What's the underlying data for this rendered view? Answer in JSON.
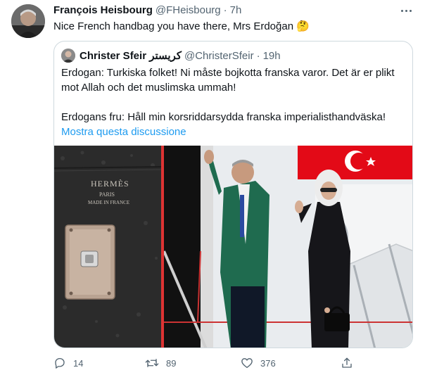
{
  "tweet": {
    "author_name": "François Heisbourg",
    "author_handle": "@FHeisbourg",
    "separator": "·",
    "time": "7h",
    "text": "Nice French handbag you have there, Mrs Erdoğan 🤔"
  },
  "quoted": {
    "author_name": "Christer Sfeir كريستر",
    "author_handle": "@ChristerSfeir",
    "separator": "·",
    "time": "19h",
    "line1": "Erdogan: Turkiska folket! Ni måste bojkotta franska varor. Det är er plikt",
    "line2": "mot Allah och det muslimska ummah!",
    "line3": "Erdogans fru: Håll min korsriddarsydda franska imperialisthandväska!",
    "show_thread": "Mostra questa discussione",
    "bag_brand": "HERMÈS",
    "bag_city": "PARIS",
    "bag_made": "MADE IN FRANCE"
  },
  "actions": {
    "replies": "14",
    "retweets": "89",
    "likes": "376"
  },
  "colors": {
    "link": "#1d9bf0",
    "muted": "#536471",
    "border": "#cfd9de",
    "flag_red": "#e30a17"
  }
}
